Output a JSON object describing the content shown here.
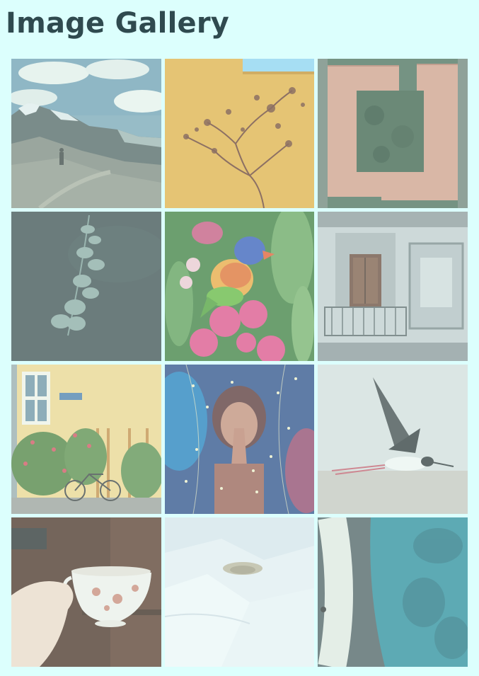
{
  "page": {
    "title": "Image Gallery",
    "background_color": "#dcfffd",
    "title_color": "#2f4a4f"
  },
  "gallery": {
    "images": [
      {
        "subject": "mountain-landscape-with-hiker"
      },
      {
        "subject": "dried-branch-on-yellow-wall"
      },
      {
        "subject": "aerial-view-of-building-courtyard"
      },
      {
        "subject": "eucalyptus-sprig-on-dark-fabric"
      },
      {
        "subject": "rainbow-lorikeet-in-pink-blossoms"
      },
      {
        "subject": "ornate-facade-with-balcony"
      },
      {
        "subject": "yellow-house-with-bicycle-and-roses"
      },
      {
        "subject": "woman-praying-with-fairy-lights"
      },
      {
        "subject": "stilt-bird-in-flight"
      },
      {
        "subject": "hand-holding-floral-teacup"
      },
      {
        "subject": "snow-covered-landscape"
      },
      {
        "subject": "fountain-basin-with-water"
      }
    ]
  }
}
